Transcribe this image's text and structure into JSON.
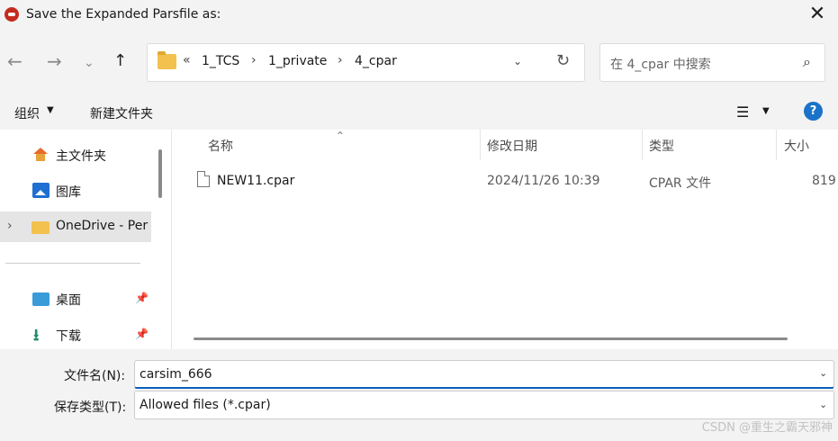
{
  "titlebar": {
    "title": "Save the Expanded Parsfile as:",
    "close_glyph": "✕",
    "app_icon": "app-icon"
  },
  "navbar": {
    "back_glyph": "←",
    "forward_glyph": "→",
    "recent_glyph": "⌄",
    "up_glyph": "↑",
    "overflow_glyph": "«",
    "breadcrumbs": [
      "1_TCS",
      "1_private",
      "4_cpar"
    ],
    "sep_glyph": "›",
    "dropdown_glyph": "⌄",
    "refresh_glyph": "↻",
    "search_placeholder": "在 4_cpar 中搜索",
    "search_glyph": "⌕"
  },
  "toolbar": {
    "organize_label": "组织",
    "organize_caret": "▼",
    "new_folder_label": "新建文件夹",
    "view_glyph": "☰",
    "view_caret": "▼",
    "help_glyph": "?"
  },
  "sidebar": {
    "items": [
      {
        "label": "主文件夹",
        "icon": "home-icon"
      },
      {
        "label": "图库",
        "icon": "gallery-icon"
      },
      {
        "label": "OneDrive - Per",
        "icon": "onedrive-folder-icon",
        "expand_glyph": "›"
      },
      {
        "label": "桌面",
        "icon": "desktop-icon",
        "pin_glyph": "📌"
      },
      {
        "label": "下载",
        "icon": "download-icon",
        "pin_glyph": "📌"
      }
    ],
    "download_glyph": "⭳"
  },
  "content": {
    "sort_glyph": "⌃",
    "columns": [
      "名称",
      "修改日期",
      "类型",
      "大小"
    ],
    "files": [
      {
        "name": "NEW11.cpar",
        "modified": "2024/11/26 10:39",
        "type": "CPAR 文件",
        "size": "819"
      }
    ]
  },
  "bottom": {
    "filename_label": "文件名(N):",
    "filename_value": "carsim_666",
    "filetype_label": "保存类型(T):",
    "filetype_value": "Allowed files (*.cpar)",
    "dropdown_glyph": "⌄",
    "watermark": "CSDN @重生之霸天邪神"
  },
  "colors": {
    "chrome_bg": "#f3f3f3",
    "accent": "#0a5fbf",
    "selected_bg": "#e5e5e5"
  }
}
